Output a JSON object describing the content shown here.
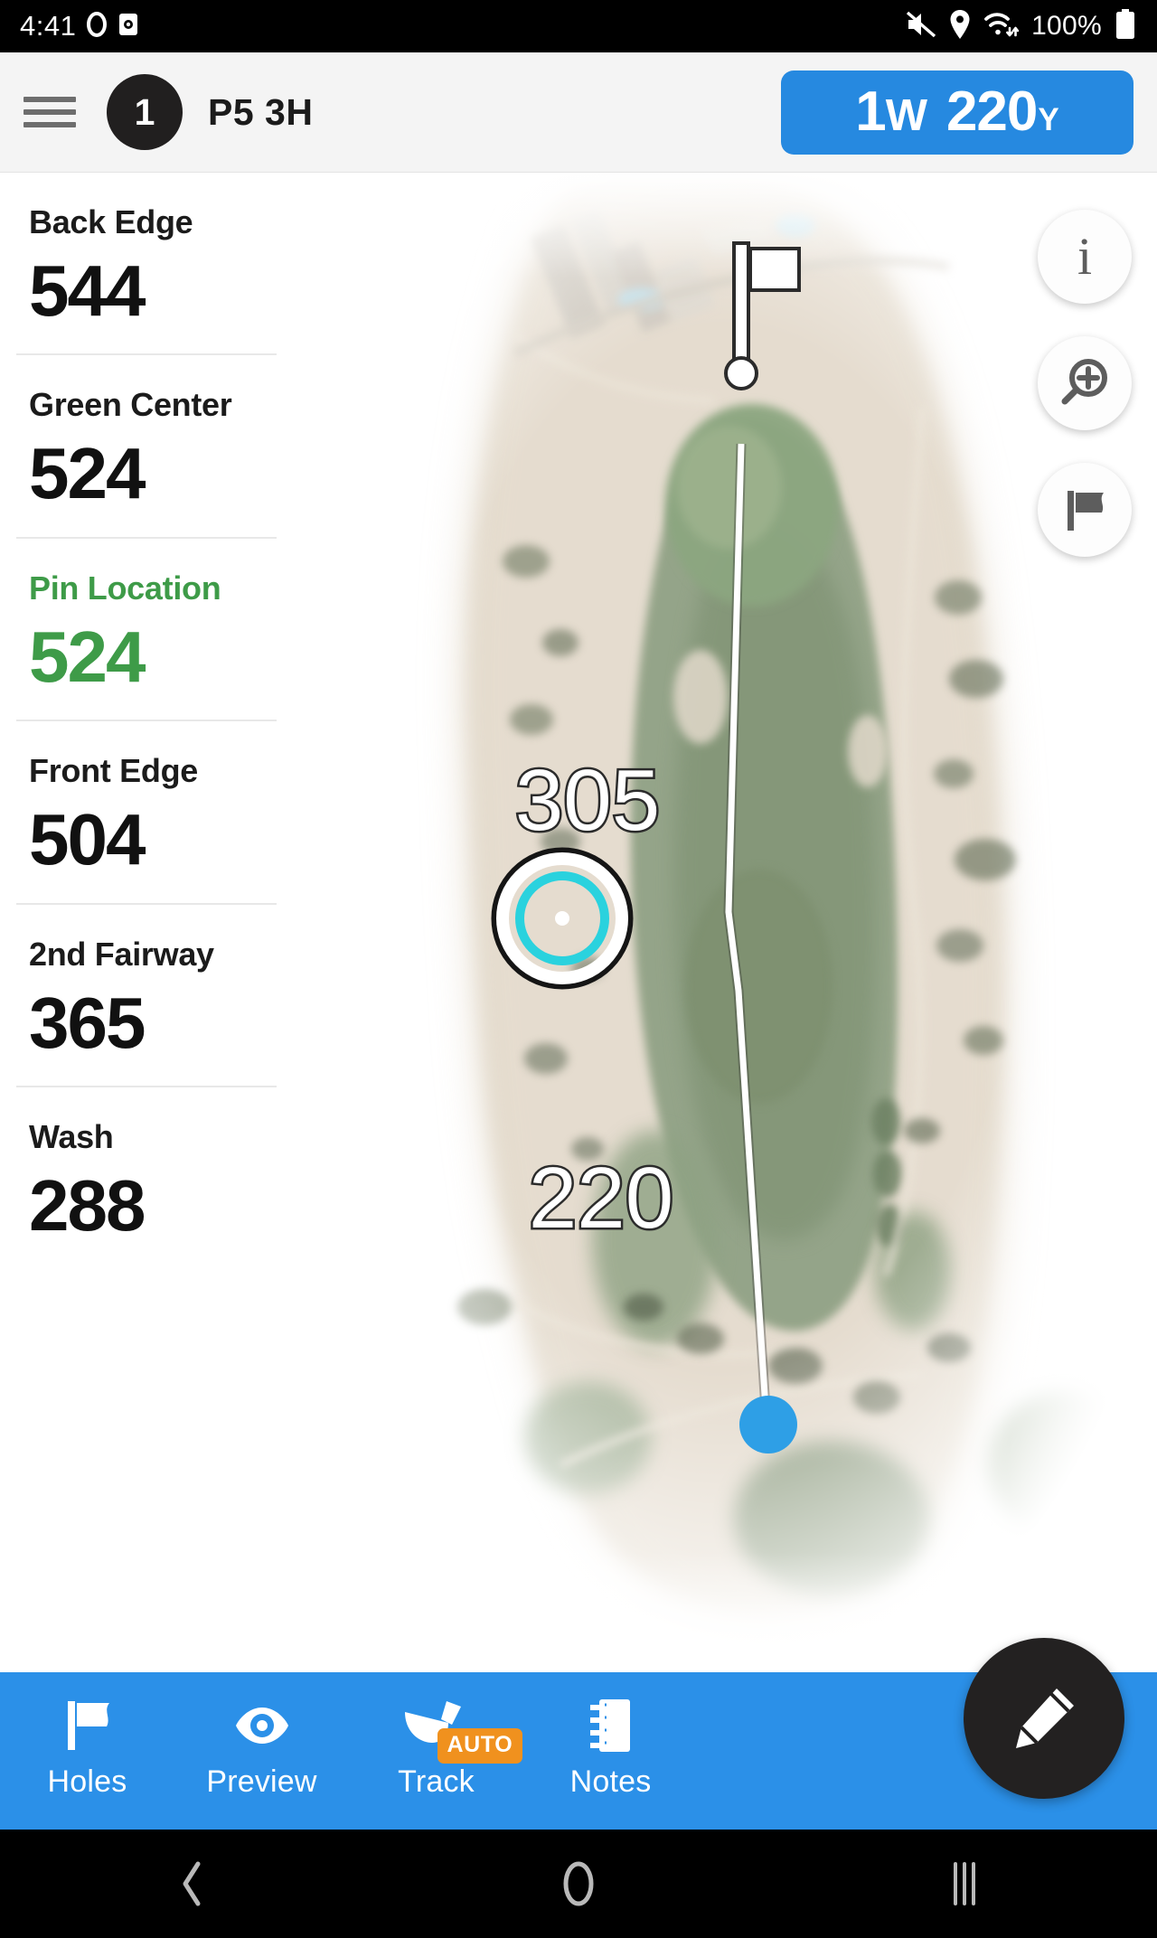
{
  "statusbar": {
    "clock": "4:41",
    "battery_percent": "100%",
    "icons": [
      "record-circle-icon",
      "camera-icon",
      "mute-icon",
      "location-pin-icon",
      "wifi-icon",
      "battery-icon"
    ]
  },
  "appbar": {
    "menu_icon": "hamburger-menu-icon",
    "hole_number": "1",
    "hole_description": "P5 3H",
    "club": {
      "name_number": "1",
      "name_letter": "W",
      "distance": "220",
      "unit": "Y"
    }
  },
  "distances": [
    {
      "label": "Back Edge",
      "value": "544",
      "highlight": false
    },
    {
      "label": "Green Center",
      "value": "524",
      "highlight": false
    },
    {
      "label": "Pin Location",
      "value": "524",
      "highlight": true
    },
    {
      "label": "Front Edge",
      "value": "504",
      "highlight": false
    },
    {
      "label": "2nd Fairway",
      "value": "365",
      "highlight": false
    },
    {
      "label": "Wash",
      "value": "288",
      "highlight": false
    }
  ],
  "map": {
    "marker_to_pin_distance": "305",
    "player_to_marker_distance": "220",
    "pin_icon": "golf-flag-icon",
    "target_icon": "target-crosshair-icon",
    "player_icon": "player-position-dot-icon"
  },
  "map_fabs": [
    {
      "name": "info-button",
      "icon": "info-icon",
      "label": "i"
    },
    {
      "name": "zoom-in-button",
      "icon": "zoom-in-icon",
      "label": ""
    },
    {
      "name": "pin-place-button",
      "icon": "flag-icon",
      "label": ""
    }
  ],
  "edit_fab": {
    "name": "edit-button",
    "icon": "pencil-icon"
  },
  "tabs": [
    {
      "label": "Holes",
      "icon": "flag-icon"
    },
    {
      "label": "Preview",
      "icon": "eye-icon"
    },
    {
      "label": "Track",
      "icon": "golf-club-icon",
      "badge": "AUTO"
    },
    {
      "label": "Notes",
      "icon": "notebook-icon"
    }
  ],
  "navbar": [
    {
      "name": "back-button",
      "icon": "chevron-left-icon"
    },
    {
      "name": "home-button",
      "icon": "circle-icon"
    },
    {
      "name": "recents-button",
      "icon": "vertical-bars-icon"
    }
  ],
  "colors": {
    "accent_blue": "#2b90e8",
    "pin_green": "#3e9b48",
    "auto_orange": "#f0911e",
    "target_cyan": "#2ad2de",
    "dark": "#232121"
  }
}
